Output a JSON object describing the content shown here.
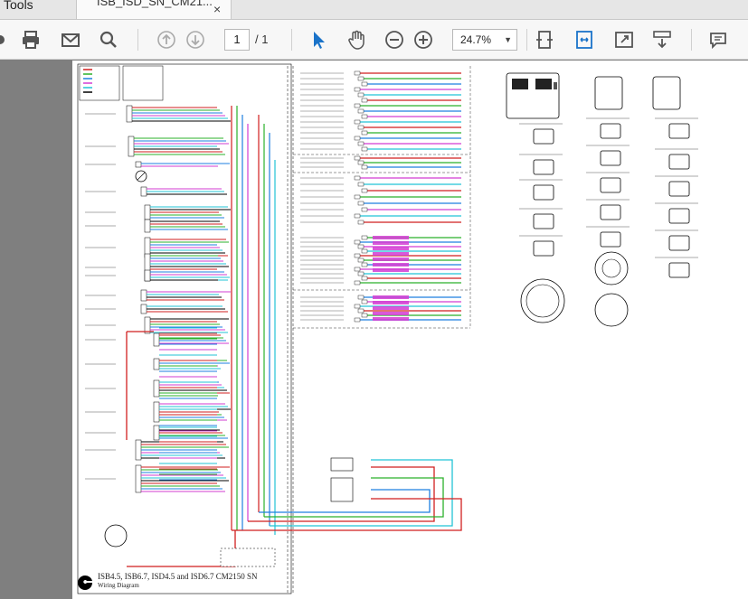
{
  "tabs": {
    "tools_label": "Tools",
    "document_tab_label": "ISB_ISD_SN_CM21...",
    "close_label": "×"
  },
  "toolbar": {
    "page_current": "1",
    "page_separator_total": "/ 1",
    "zoom_value": "24.7%"
  },
  "document": {
    "diagram_title": "ISB4.5, ISB6.7, ISD4.5 and ISD6.7 CM2150 SN",
    "diagram_subtitle": "Wiring Diagram"
  },
  "colors": {
    "accent_blue": "#1a73c9",
    "wire_red": "#d11f1f",
    "wire_green": "#2bb02b",
    "wire_blue": "#1e7fe0",
    "wire_magenta": "#d23cd2",
    "wire_cyan": "#22c3d6"
  }
}
